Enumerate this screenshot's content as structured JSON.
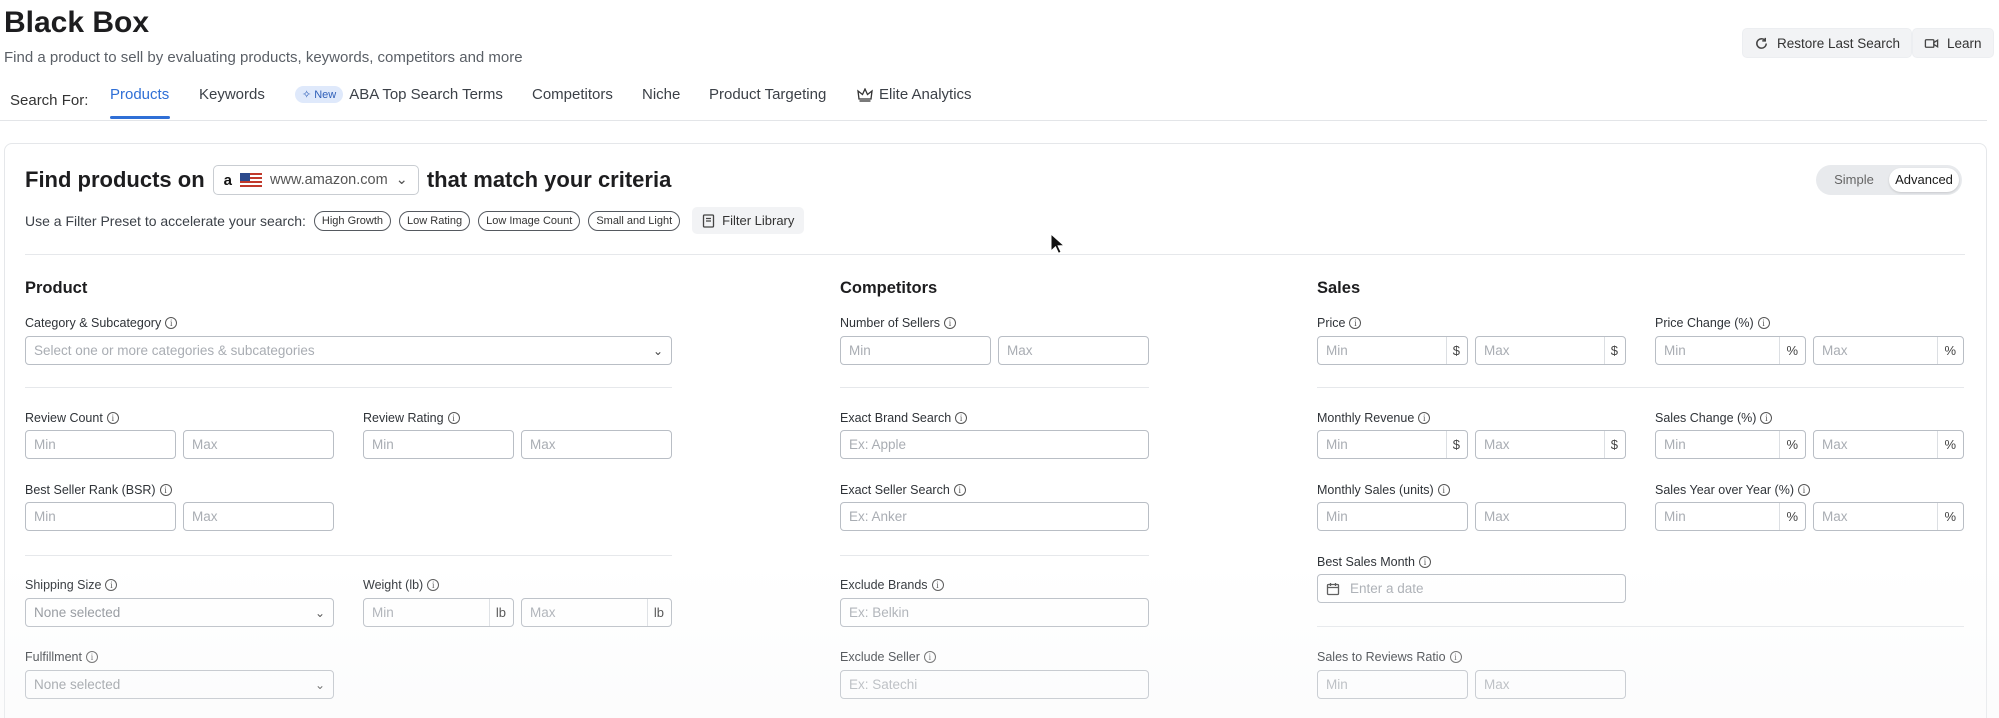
{
  "header": {
    "title": "Black Box",
    "subtitle": "Find a product to sell by evaluating products, keywords, competitors and more",
    "restore_label": "Restore Last Search",
    "learn_label": "Learn"
  },
  "tabs": {
    "search_for": "Search For:",
    "items": [
      {
        "label": "Products"
      },
      {
        "label": "Keywords"
      },
      {
        "badge": "New",
        "label": "ABA Top Search Terms"
      },
      {
        "label": "Competitors"
      },
      {
        "label": "Niche"
      },
      {
        "label": "Product Targeting"
      },
      {
        "label": "Elite Analytics"
      }
    ]
  },
  "find": {
    "prefix": "Find products on",
    "marketplace": "www.amazon.com",
    "marketplace_logo": "a",
    "suffix": "that match your criteria"
  },
  "mode": {
    "simple": "Simple",
    "advanced": "Advanced",
    "selected": "Advanced"
  },
  "presets": {
    "intro": "Use a Filter Preset to accelerate your search:",
    "chips": [
      "High Growth",
      "Low Rating",
      "Low Image Count",
      "Small and Light"
    ],
    "library_label": "Filter Library"
  },
  "product": {
    "title": "Product",
    "category": {
      "label": "Category & Subcategory",
      "placeholder": "Select one or more categories & subcategories"
    },
    "review_count": {
      "label": "Review Count",
      "min": "Min",
      "max": "Max"
    },
    "review_rating": {
      "label": "Review Rating",
      "min": "Min",
      "max": "Max"
    },
    "bsr": {
      "label": "Best Seller Rank (BSR)",
      "min": "Min",
      "max": "Max"
    },
    "shipping_size": {
      "label": "Shipping Size",
      "placeholder": "None selected"
    },
    "weight": {
      "label": "Weight (lb)",
      "min": "Min",
      "max": "Max",
      "unit": "lb"
    },
    "fulfillment": {
      "label": "Fulfillment",
      "placeholder": "None selected"
    }
  },
  "competitors": {
    "title": "Competitors",
    "num_sellers": {
      "label": "Number of Sellers",
      "min": "Min",
      "max": "Max"
    },
    "exact_brand": {
      "label": "Exact Brand Search",
      "placeholder": "Ex: Apple"
    },
    "exact_seller": {
      "label": "Exact Seller Search",
      "placeholder": "Ex: Anker"
    },
    "exclude_brands": {
      "label": "Exclude Brands",
      "placeholder": "Ex: Belkin"
    },
    "exclude_seller": {
      "label": "Exclude Seller",
      "placeholder": "Ex: Satechi"
    }
  },
  "sales": {
    "title": "Sales",
    "price": {
      "label": "Price",
      "min": "Min",
      "max": "Max",
      "unit": "$"
    },
    "price_change": {
      "label": "Price Change (%)",
      "min": "Min",
      "max": "Max",
      "unit": "%"
    },
    "monthly_revenue": {
      "label": "Monthly Revenue",
      "min": "Min",
      "max": "Max",
      "unit": "$"
    },
    "sales_change": {
      "label": "Sales Change (%)",
      "min": "Min",
      "max": "Max",
      "unit": "%"
    },
    "monthly_sales": {
      "label": "Monthly Sales (units)",
      "min": "Min",
      "max": "Max"
    },
    "sales_yoy": {
      "label": "Sales Year over Year (%)",
      "min": "Min",
      "max": "Max",
      "unit": "%"
    },
    "best_month": {
      "label": "Best Sales Month",
      "placeholder": "Enter a date"
    },
    "sales_reviews": {
      "label": "Sales to Reviews Ratio",
      "min": "Min",
      "max": "Max"
    }
  },
  "colors": {
    "accent": "#2f6fd6",
    "border": "#b9bec5",
    "placeholder": "#a9adb3"
  }
}
